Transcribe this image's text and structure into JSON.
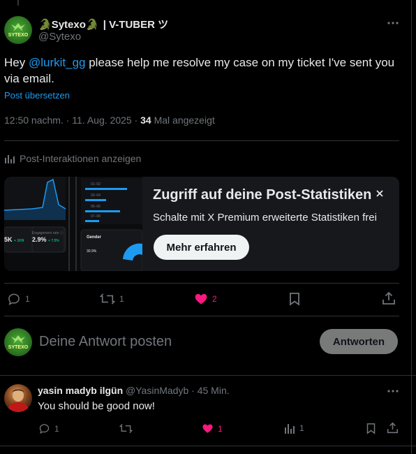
{
  "post": {
    "display_name_emoji_left": "🐊",
    "display_name": "Sytexo",
    "display_name_emoji_right": "🐊",
    "display_name_suffix": "| V-TUBER ツ",
    "handle": "@Sytexo",
    "avatar_text": "SYTEXO",
    "text_before": "Hey ",
    "mention": "@lurkit_gg",
    "text_after": " please help me resolve my case on my ticket I've sent you via email.",
    "translate_label": "Post übersetzen",
    "time": "12:50 nachm.",
    "separator": "·",
    "date": "11. Aug. 2025",
    "views": "34",
    "views_label": "Mal angezeigt",
    "interactions_label": "Post-Interaktionen anzeigen"
  },
  "premium_card": {
    "title": "Zugriff auf deine Post-Statistiken",
    "subtitle": "Schalte mit X Premium erweiterte Statistiken frei",
    "button": "Mehr erfahren",
    "preview_stat_1": "5K",
    "preview_stat_1_delta": "+ 1KN",
    "preview_stat_2_label": "Engagement rate ⓘ",
    "preview_stat_2": "2.9%",
    "preview_stat_2_delta": "+ 7.5%",
    "preview_gender_label": "Gender",
    "preview_gender_value": "30.9%",
    "preview_small_labels": [
      "01–02",
      "03–04",
      "05–06",
      "07–08"
    ]
  },
  "actions": {
    "replies": "1",
    "reposts": "1",
    "likes": "2"
  },
  "reply_box": {
    "placeholder": "Deine Antwort posten",
    "button": "Antworten"
  },
  "reply": {
    "name": "yasin madyb ilgün",
    "handle": "@YasinMadyb",
    "separator": "·",
    "time": "45 Min.",
    "text": "You should be good now!",
    "replies": "1",
    "likes": "1",
    "views": "1"
  },
  "colors": {
    "accent": "#1d9bf0",
    "like": "#f91880",
    "text": "#e7e9ea",
    "muted": "#71767b",
    "border": "#2f3336",
    "card_bg": "#16181c"
  }
}
